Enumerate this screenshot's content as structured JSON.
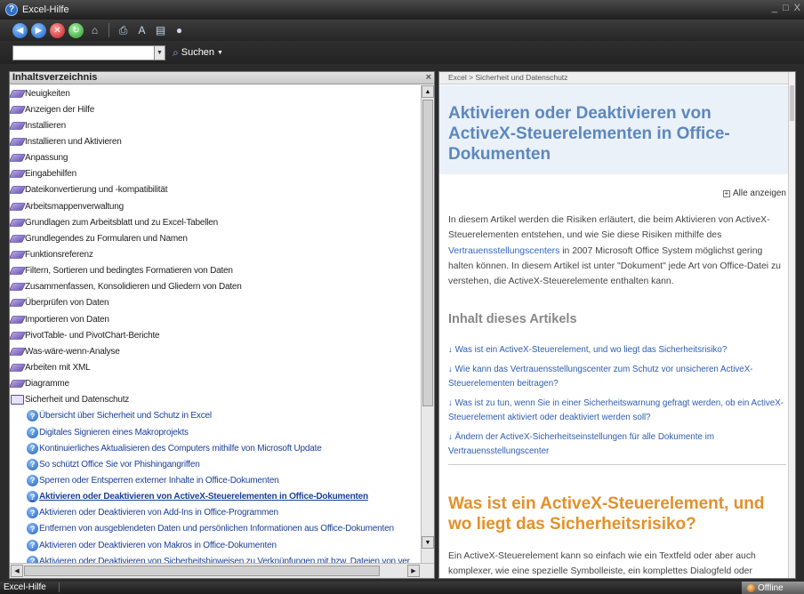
{
  "window": {
    "title": "Excel-Hilfe",
    "controls": [
      "_",
      "□",
      "X"
    ]
  },
  "search": {
    "value": "",
    "button_label": "Suchen",
    "dropdown_glyph": "▼"
  },
  "toc": {
    "header": "Inhaltsverzeichnis",
    "close_glyph": "×",
    "items": [
      {
        "label": "Neuigkeiten",
        "type": "book"
      },
      {
        "label": "Anzeigen der Hilfe",
        "type": "book"
      },
      {
        "label": "Installieren",
        "type": "book"
      },
      {
        "label": "Installieren und Aktivieren",
        "type": "book"
      },
      {
        "label": "Anpassung",
        "type": "book"
      },
      {
        "label": "Eingabehilfen",
        "type": "book"
      },
      {
        "label": "Dateikonvertierung und -kompatibilität",
        "type": "book"
      },
      {
        "label": "Arbeitsmappenverwaltung",
        "type": "book"
      },
      {
        "label": "Grundlagen zum Arbeitsblatt und zu Excel-Tabellen",
        "type": "book"
      },
      {
        "label": "Grundlegendes zu Formularen und Namen",
        "type": "book"
      },
      {
        "label": "Funktionsreferenz",
        "type": "book"
      },
      {
        "label": "Filtern, Sortieren und bedingtes Formatieren von Daten",
        "type": "book"
      },
      {
        "label": "Zusammenfassen, Konsolidieren und Gliedern von Daten",
        "type": "book"
      },
      {
        "label": "Überprüfen von Daten",
        "type": "book"
      },
      {
        "label": "Importieren von Daten",
        "type": "book"
      },
      {
        "label": "PivotTable- und PivotChart-Berichte",
        "type": "book"
      },
      {
        "label": "Was-wäre-wenn-Analyse",
        "type": "book"
      },
      {
        "label": "Arbeiten mit XML",
        "type": "book"
      },
      {
        "label": "Diagramme",
        "type": "book"
      },
      {
        "label": "Sicherheit und Datenschutz",
        "type": "open"
      },
      {
        "label": "Übersicht über Sicherheit und Schutz in Excel",
        "type": "topic"
      },
      {
        "label": "Digitales Signieren eines Makroprojekts",
        "type": "topic"
      },
      {
        "label": "Kontinuierliches Aktualisieren des Computers mithilfe von Microsoft Update",
        "type": "topic"
      },
      {
        "label": "So schützt Office Sie vor Phishingangriffen",
        "type": "topic"
      },
      {
        "label": "Sperren oder Entsperren externer Inhalte in Office-Dokumenten",
        "type": "topic"
      },
      {
        "label": "Aktivieren oder Deaktivieren von ActiveX-Steuerelementen in Office-Dokumenten",
        "type": "topic",
        "selected": true
      },
      {
        "label": "Aktivieren oder Deaktivieren von Add-Ins in Office-Programmen",
        "type": "topic"
      },
      {
        "label": "Entfernen von ausgeblendeten Daten und persönlichen Informationen aus Office-Dokumenten",
        "type": "topic"
      },
      {
        "label": "Aktivieren oder Deaktivieren von Makros in Office-Dokumenten",
        "type": "topic"
      },
      {
        "label": "Aktivieren oder Deaktivieren von Sicherheitshinweisen zu Verknüpfungen mit bzw. Dateien von ver",
        "type": "topic"
      }
    ]
  },
  "article": {
    "breadcrumb": "Excel > Sicherheit und Datenschutz",
    "title": "Aktivieren oder Deaktivieren von ActiveX-Steuerelementen in Office-Dokumenten",
    "show_all": "Alle anzeigen",
    "intro_part1": "In diesem Artikel werden die Risiken erläutert, die beim Aktivieren von ActiveX-Steuerelementen entstehen, und wie Sie diese Risiken mithilfe des ",
    "intro_link": "Vertrauensstellungscenters",
    "intro_part2": " in 2007 Microsoft Office System möglichst gering halten können. In diesem Artikel ist unter \"Dokument\" jede Art von Office-Datei zu verstehen, die ActiveX-Steuerelemente enthalten kann.",
    "contents_heading": "Inhalt dieses Artikels",
    "links": [
      "Was ist ein ActiveX-Steuerelement, und wo liegt das Sicherheitsrisiko?",
      "Wie kann das Vertrauensstellungscenter zum Schutz vor unsicheren ActiveX-Steuerelementen beitragen?",
      "Was ist zu tun, wenn Sie in einer Sicherheitswarnung gefragt werden, ob ein ActiveX-Steuerelement aktiviert oder deaktiviert werden soll?",
      "Ändern der ActiveX-Sicherheitseinstellungen für alle Dokumente im Vertrauensstellungscenter"
    ],
    "link_prefix": "↓",
    "section_heading": "Was ist ein ActiveX-Steuerelement, und wo liegt das Sicherheitsrisiko?",
    "section_text": "Ein ActiveX-Steuerelement kann so einfach wie ein Textfeld oder aber auch komplexer, wie eine spezielle Symbolleiste, ein komplettes Dialogfeld oder"
  },
  "status": {
    "app_name": "Excel-Hilfe",
    "connection": "Offline"
  },
  "colors": {
    "title_blue": "#5d87bd",
    "section_orange": "#e3902b",
    "link_blue": "#2e5db3"
  }
}
